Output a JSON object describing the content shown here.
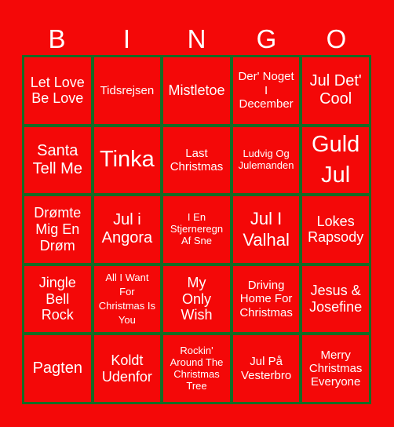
{
  "header": {
    "letters": [
      "B",
      "I",
      "N",
      "G",
      "O"
    ]
  },
  "colors": {
    "background": "#f40808",
    "grid": "#166b25",
    "text": "#ffffff"
  },
  "board": {
    "cells": [
      [
        "Let Love Be Love",
        "Tidsrejsen",
        "Mistletoe",
        "Der' Noget I December",
        "Jul Det' Cool"
      ],
      [
        "Santa Tell Me",
        "Tinka",
        "Last Christmas",
        "Ludvig Og Julemanden",
        "Guld Jul"
      ],
      [
        "Drømte Mig En Drøm",
        "Jul i Angora",
        "I En Stjerneregn Af Sne",
        "Jul I Valhal",
        "Lokes Rapsody"
      ],
      [
        "Jingle Bell Rock",
        "All I Want For Christmas Is You",
        "My Only Wish",
        "Driving Home For Christmas",
        "Jesus & Josefine"
      ],
      [
        "Pagten",
        "Koldt Udenfor",
        "Rockin' Around The Christmas Tree",
        "Jul På Vesterbro",
        "Merry Christmas Everyone"
      ]
    ]
  }
}
